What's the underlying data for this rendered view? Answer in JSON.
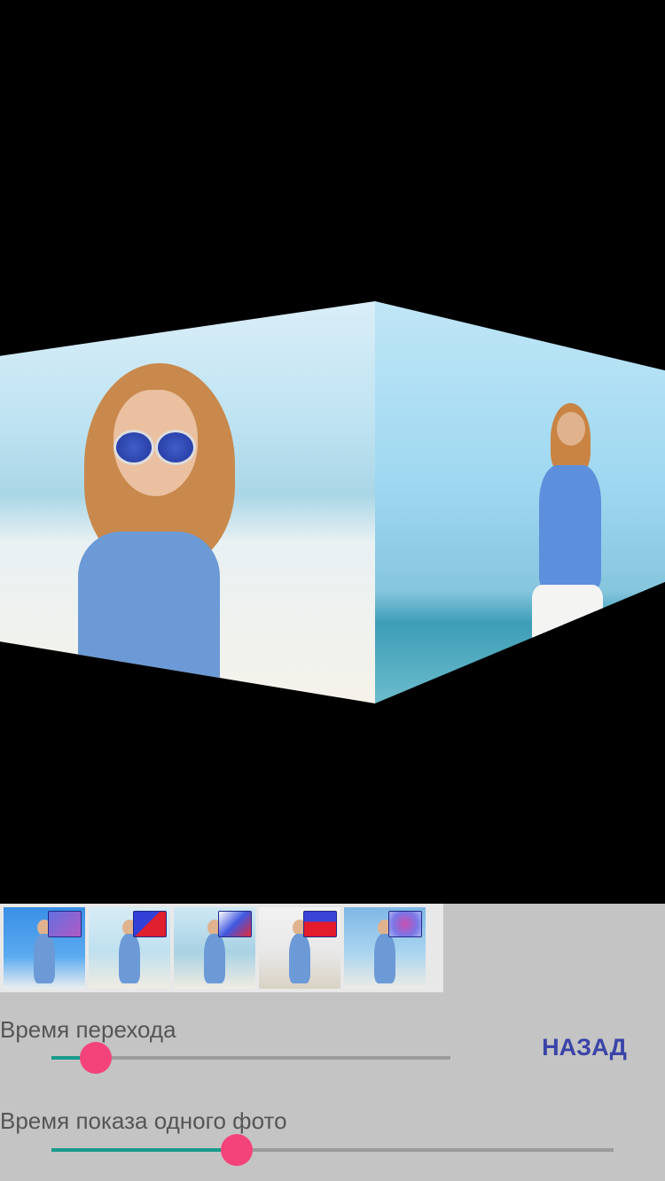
{
  "preview": {
    "left_face_image": "beach-woman-sunglasses-photo",
    "right_face_image": "beach-woman-standing-photo"
  },
  "thumbnails": [
    {
      "image": "woman-blue-sky-photo",
      "badge_icon": "transition-effect-icon-purple",
      "selected": true
    },
    {
      "image": "woman-sunglasses-beach-photo",
      "badge_icon": "transition-effect-icon-blue-red",
      "selected": false
    },
    {
      "image": "woman-smile-beach-photo",
      "badge_icon": "transition-effect-icon-gradient",
      "selected": false
    },
    {
      "image": "woman-walking-beach-photo",
      "badge_icon": "transition-effect-icon-stripes",
      "selected": false
    },
    {
      "image": "woman-sea-shore-photo",
      "badge_icon": "transition-effect-icon-radial",
      "selected": false
    }
  ],
  "transition_time": {
    "label": "Время перехода",
    "value_fraction": 0.11
  },
  "display_time": {
    "label": "Время показа одного фото",
    "value_fraction": 0.33
  },
  "back_button": {
    "label": "НАЗАД"
  },
  "colors": {
    "slider_fill": "#199a8b",
    "slider_thumb": "#f4437a",
    "accent_text": "#3a44a8"
  }
}
